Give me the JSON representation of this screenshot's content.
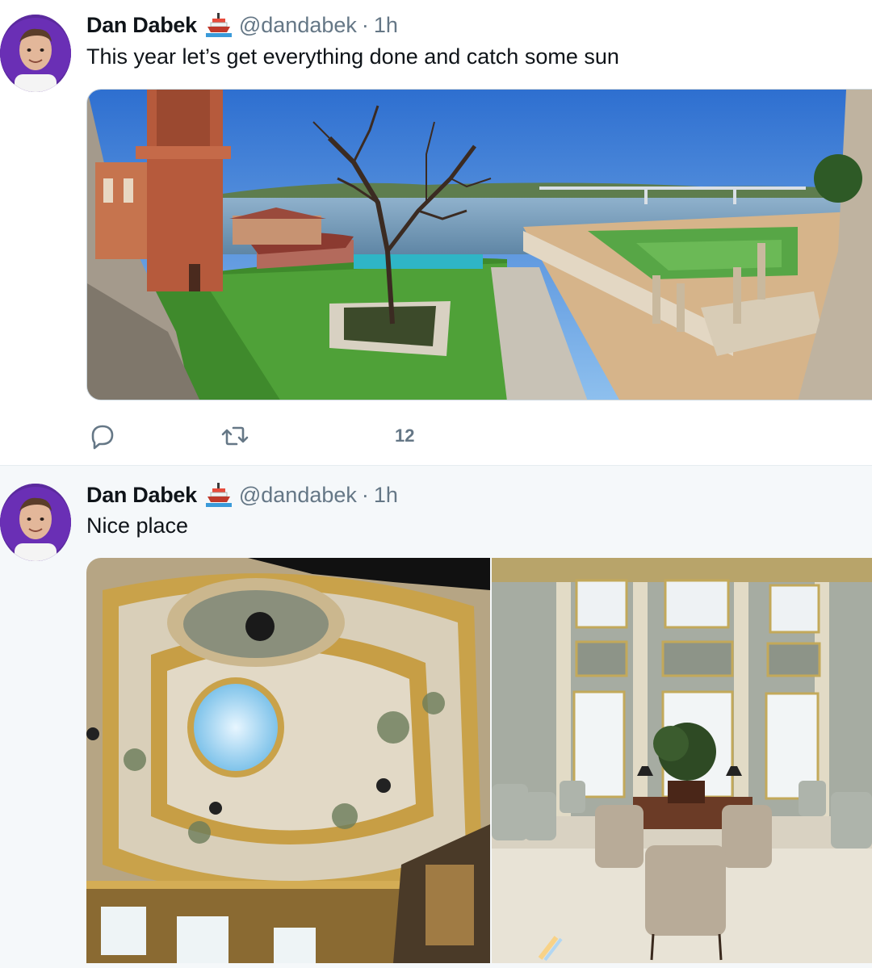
{
  "tweets": [
    {
      "author_name": "Dan Dabek",
      "badge_icon": "ship-emoji-icon",
      "handle": "@dandabek",
      "separator": "·",
      "time": "1h",
      "text": "This year let’s get everything done and catch some sun",
      "media": [
        {
          "type": "photo",
          "subject": "panorama-garden-river"
        }
      ],
      "actions": {
        "reply_icon": "reply-icon",
        "retweet_icon": "retweet-icon",
        "like_count": "12"
      }
    },
    {
      "author_name": "Dan Dabek",
      "badge_icon": "ship-emoji-icon",
      "handle": "@dandabek",
      "separator": "·",
      "time": "1h",
      "text": "Nice place",
      "media": [
        {
          "type": "photo",
          "subject": "ornate-ceiling-skylight"
        },
        {
          "type": "photo",
          "subject": "grand-lounge-interior"
        }
      ]
    }
  ],
  "colors": {
    "primary_text": "#0f1419",
    "secondary_text": "#657786",
    "divider": "#e6ecf0",
    "highlight_bg": "#f5f8fa",
    "avatar_bg": "#5b2a9e"
  }
}
